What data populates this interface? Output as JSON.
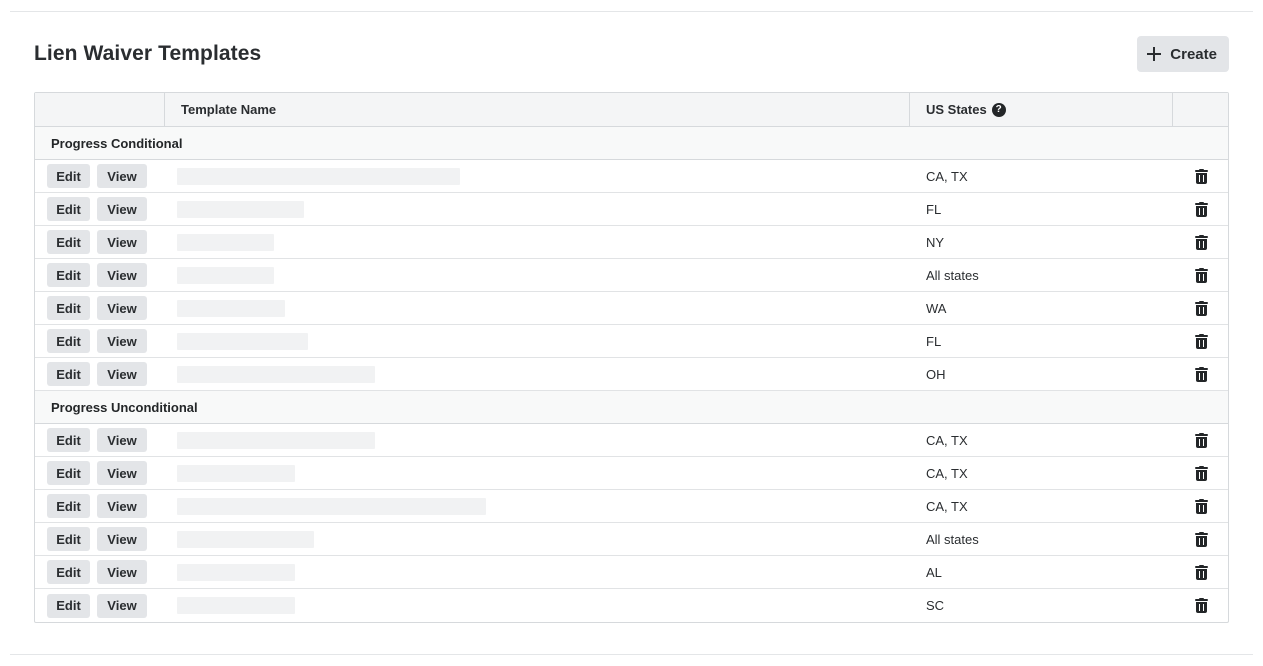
{
  "page": {
    "title": "Lien Waiver Templates",
    "create_label": "Create"
  },
  "table": {
    "columns": {
      "actions": "",
      "template_name": "Template Name",
      "us_states": "US States",
      "help_glyph": "?"
    },
    "actions": {
      "edit_label": "Edit",
      "view_label": "View"
    },
    "groups": [
      {
        "name": "Progress Conditional",
        "rows": [
          {
            "template_name": "",
            "states": "CA, TX",
            "redacted_fraction": 0.38
          },
          {
            "template_name": "",
            "states": "FL",
            "redacted_fraction": 0.17
          },
          {
            "template_name": "",
            "states": "NY",
            "redacted_fraction": 0.13
          },
          {
            "template_name": "",
            "states": "All states",
            "redacted_fraction": 0.13
          },
          {
            "template_name": "",
            "states": "WA",
            "redacted_fraction": 0.145
          },
          {
            "template_name": "",
            "states": "FL",
            "redacted_fraction": 0.176
          },
          {
            "template_name": "",
            "states": "OH",
            "redacted_fraction": 0.266
          }
        ]
      },
      {
        "name": "Progress Unconditional",
        "rows": [
          {
            "template_name": "",
            "states": "CA, TX",
            "redacted_fraction": 0.266
          },
          {
            "template_name": "",
            "states": "CA, TX",
            "redacted_fraction": 0.159
          },
          {
            "template_name": "",
            "states": "CA, TX",
            "redacted_fraction": 0.415
          },
          {
            "template_name": "",
            "states": "All states",
            "redacted_fraction": 0.184
          },
          {
            "template_name": "",
            "states": "AL",
            "redacted_fraction": 0.159
          },
          {
            "template_name": "",
            "states": "SC",
            "redacted_fraction": 0.159
          }
        ]
      }
    ]
  },
  "icons": {
    "create": "plus-icon",
    "help": "question-circle-icon",
    "delete": "trash-icon"
  },
  "colors": {
    "button_bg": "#e3e5e8",
    "header_bg": "#f4f5f6",
    "border": "#d6d9dc",
    "text": "#232628"
  }
}
